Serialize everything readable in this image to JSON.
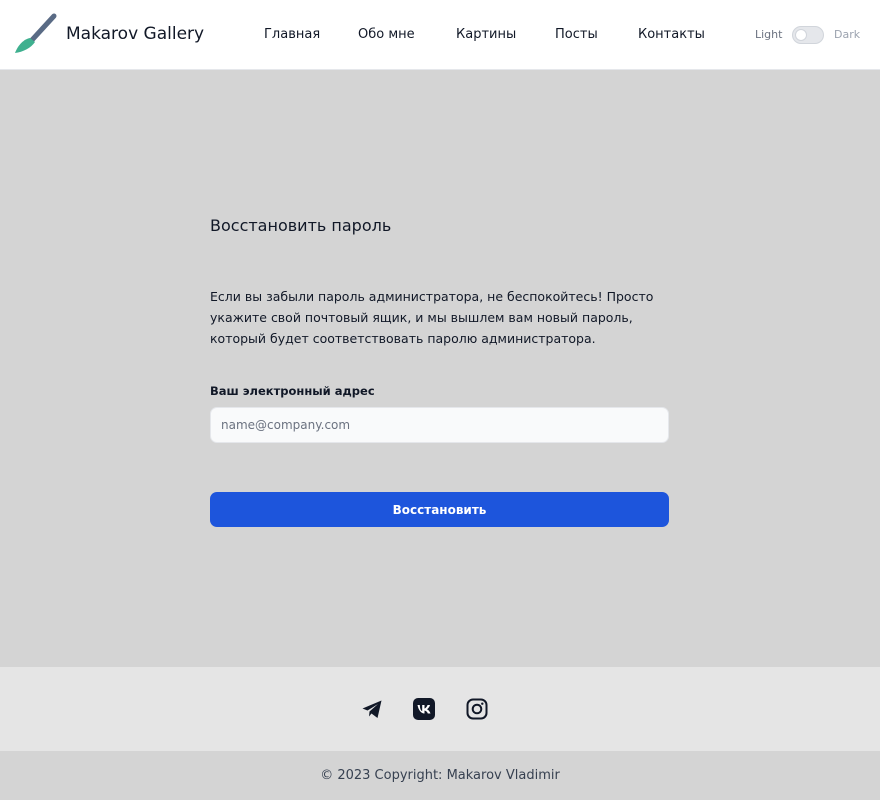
{
  "header": {
    "brand": "Makarov Gallery",
    "logo_icon": "paintbrush-icon",
    "nav": [
      "Главная",
      "Обо мне",
      "Картины",
      "Посты",
      "Контакты"
    ],
    "theme": {
      "light_label": "Light",
      "dark_label": "Dark",
      "mode": "light"
    }
  },
  "main": {
    "title": "Восстановить пароль",
    "description": "Если вы забыли пароль администратора, не беспокойтесь! Просто укажите свой почтовый ящик, и мы вышлем вам новый пароль, который будет соответствовать паролю администратора.",
    "email_label": "Ваш электронный адрес",
    "email_placeholder": "name@company.com",
    "email_value": "",
    "submit_label": "Восстановить"
  },
  "footer": {
    "social_icons": [
      "telegram-icon",
      "vk-icon",
      "instagram-icon"
    ],
    "copyright": "© 2023 Copyright: Makarov Vladimir"
  },
  "colors": {
    "page_background": "#d4d4d4",
    "header_background": "#ffffff",
    "primary_button": "#1d55dc",
    "social_bar_background": "#e5e5e5",
    "logo_handle": "#5a6b85",
    "logo_tip": "#3fb08f"
  }
}
